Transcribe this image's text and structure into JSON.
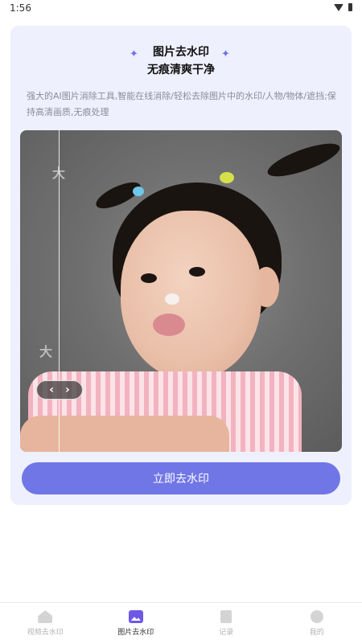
{
  "status_bar": {
    "time": "1:56"
  },
  "card": {
    "title": "图片去水印",
    "subtitle": "无痕清爽干净",
    "description": "强大的AI图片消除工具,智能在线消除/轻松去除图片中的水印/人物/物体/遮挡;保持高清画质,无痕处理",
    "sparkle_glyph": "✦",
    "compare_left": "‹",
    "compare_right": "›",
    "watermark_text": "大",
    "button_label": "立即去水印"
  },
  "bottom_nav": {
    "items": [
      {
        "label": "视频去水印",
        "icon": "home-icon",
        "active": false
      },
      {
        "label": "图片去水印",
        "icon": "image-icon",
        "active": true
      },
      {
        "label": "记录",
        "icon": "record-icon",
        "active": false
      },
      {
        "label": "我的",
        "icon": "profile-icon",
        "active": false
      }
    ]
  },
  "colors": {
    "accent": "#7076e6",
    "card_bg": "#eef0fd",
    "active_icon": "#6f58e6"
  }
}
